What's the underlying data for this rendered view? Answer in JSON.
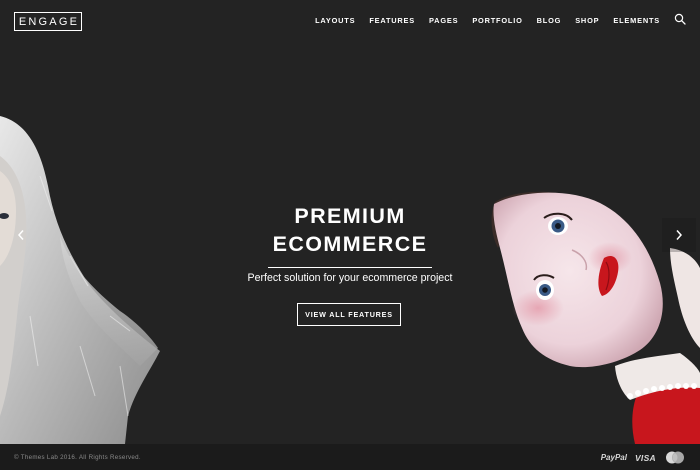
{
  "header": {
    "logo": "ENGAGE",
    "nav": [
      "LAYOUTS",
      "FEATURES",
      "PAGES",
      "PORTFOLIO",
      "BLOG",
      "SHOP",
      "ELEMENTS"
    ]
  },
  "hero": {
    "headline_line1": "PREMIUM",
    "headline_line2": "ECOMMERCE",
    "subtitle": "Perfect solution for your ecommerce project",
    "cta_label": "VIEW ALL FEATURES",
    "prev_icon": "chevron-left-icon",
    "next_icon": "chevron-right-icon"
  },
  "footer": {
    "copyright": "© Themes Lab 2016. All Rights Reserved.",
    "payments": {
      "paypal": "PayPal",
      "visa": "VISA",
      "mastercard_icon": "mastercard-icon"
    }
  },
  "colors": {
    "background": "#232323",
    "footer_background": "#1b1b1b",
    "text": "#ffffff",
    "accent_red": "#c8161d"
  }
}
